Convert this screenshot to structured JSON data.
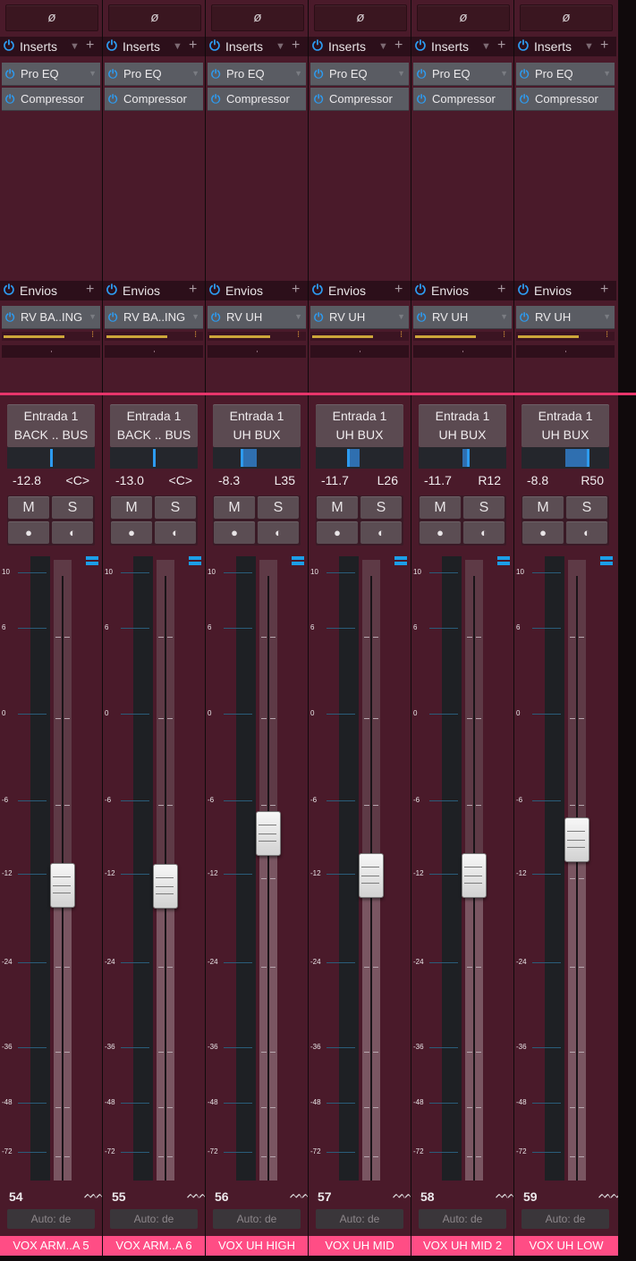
{
  "colors": {
    "channel_bg": "#4a1a2a",
    "accent_blue": "#2d9bf0",
    "separator_pink": "#e8356b",
    "name_bar_pink": "#ff4d85",
    "send_level_gold": "#cda63a"
  },
  "common": {
    "phase_symbol": "ø",
    "inserts_label": "Inserts",
    "sends_label": "Envios",
    "insert_slot_1": "Pro EQ",
    "insert_slot_2": "Compressor",
    "mute_label": "M",
    "solo_label": "S",
    "record_glyph": "●",
    "monitor_glyph": "◐",
    "power_glyph": "⏻",
    "plus_glyph": "+",
    "dropdown_glyph": "▼",
    "auto_label": "Auto: de",
    "wave_glyph": "ᨓᨓ",
    "scale_ticks": [
      "10",
      "6",
      "0",
      "-6",
      "-12",
      "-24",
      "-36",
      "-48",
      "-72"
    ]
  },
  "channels": [
    {
      "number": "54",
      "input": "Entrada 1",
      "output": "BACK .. BUS",
      "volume": "-12.8",
      "pan": "<C>",
      "pan_position": 0.5,
      "send": "RV BA..ING",
      "send_level": 0.72,
      "fader_db": -12.8,
      "meter_level": 0.48,
      "name": "VOX ARM..A  5"
    },
    {
      "number": "55",
      "input": "Entrada 1",
      "output": "BACK .. BUS",
      "volume": "-13.0",
      "pan": "<C>",
      "pan_position": 0.5,
      "send": "RV BA..ING",
      "send_level": 0.72,
      "fader_db": -13.0,
      "meter_level": 0.48,
      "name": "VOX ARM..A  6"
    },
    {
      "number": "56",
      "input": "Entrada 1",
      "output": "UH BUX",
      "volume": "-8.3",
      "pan": "L35",
      "pan_position": 0.33,
      "send": "RV UH",
      "send_level": 0.72,
      "fader_db": -8.3,
      "meter_level": 0.55,
      "name": "VOX UH HIGH"
    },
    {
      "number": "57",
      "input": "Entrada 1",
      "output": "UH BUX",
      "volume": "-11.7",
      "pan": "L26",
      "pan_position": 0.37,
      "send": "RV UH",
      "send_level": 0.72,
      "fader_db": -11.7,
      "meter_level": 0.5,
      "name": "VOX UH MID"
    },
    {
      "number": "58",
      "input": "Entrada 1",
      "output": "UH BUX",
      "volume": "-11.7",
      "pan": "R12",
      "pan_position": 0.56,
      "send": "RV UH",
      "send_level": 0.72,
      "fader_db": -11.7,
      "meter_level": 0.5,
      "name": "VOX UH MID 2"
    },
    {
      "number": "59",
      "input": "Entrada 1",
      "output": "UH BUX",
      "volume": "-8.8",
      "pan": "R50",
      "pan_position": 0.75,
      "send": "RV UH",
      "send_level": 0.72,
      "fader_db": -8.8,
      "meter_level": 0.55,
      "name": "VOX UH LOW"
    }
  ]
}
